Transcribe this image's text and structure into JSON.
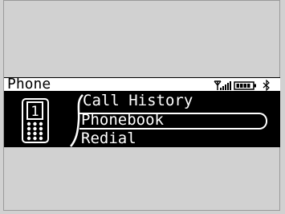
{
  "screen": {
    "title": "Phone",
    "status_icons": [
      "antenna-icon",
      "signal-strength-icon",
      "battery-icon",
      "bluetooth-icon"
    ],
    "menu": [
      {
        "label": "Call History",
        "selected": false
      },
      {
        "label": "Phonebook",
        "selected": true
      },
      {
        "label": "Redial",
        "selected": false
      }
    ],
    "phone_icon_digit": "1"
  },
  "colors": {
    "background": "#d1d1d1",
    "display": "#000000",
    "text": "#ffffff",
    "titlebar": "#ffffff"
  }
}
